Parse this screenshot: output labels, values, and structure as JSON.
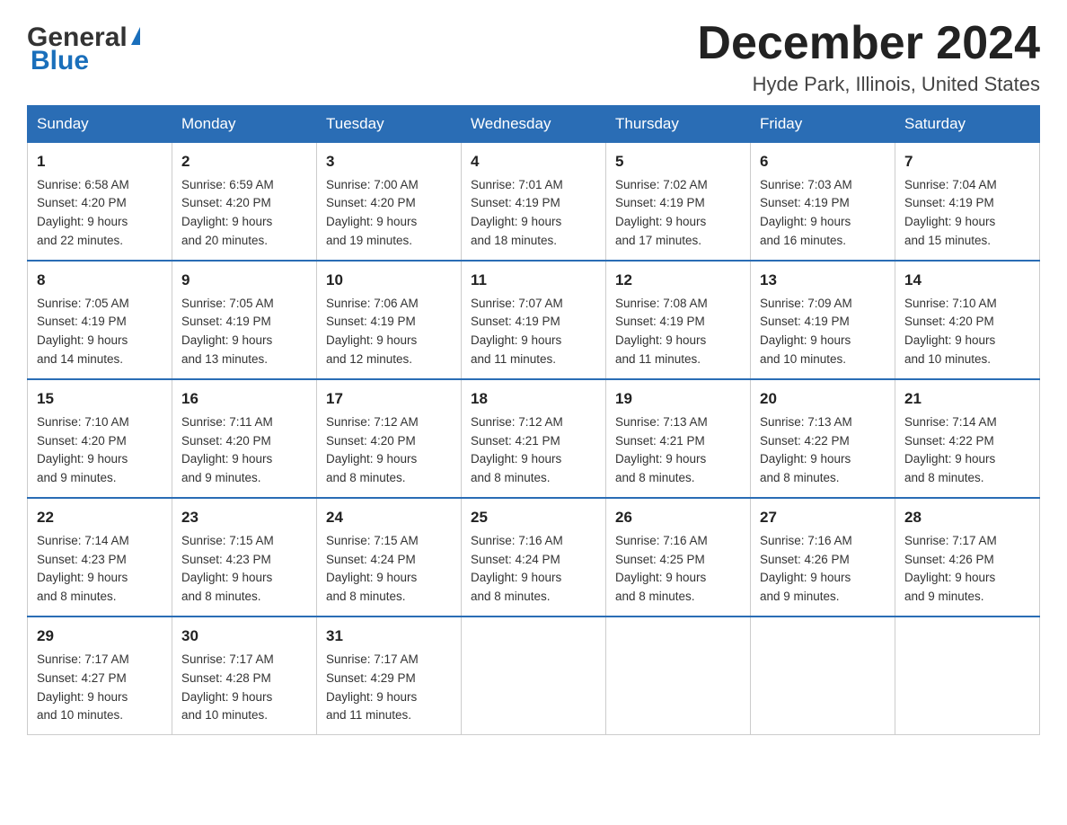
{
  "logo": {
    "general": "General",
    "blue": "Blue",
    "triangle": "▲"
  },
  "title": "December 2024",
  "location": "Hyde Park, Illinois, United States",
  "days_of_week": [
    "Sunday",
    "Monday",
    "Tuesday",
    "Wednesday",
    "Thursday",
    "Friday",
    "Saturday"
  ],
  "weeks": [
    [
      {
        "day": "1",
        "sunrise": "6:58 AM",
        "sunset": "4:20 PM",
        "daylight": "9 hours and 22 minutes."
      },
      {
        "day": "2",
        "sunrise": "6:59 AM",
        "sunset": "4:20 PM",
        "daylight": "9 hours and 20 minutes."
      },
      {
        "day": "3",
        "sunrise": "7:00 AM",
        "sunset": "4:20 PM",
        "daylight": "9 hours and 19 minutes."
      },
      {
        "day": "4",
        "sunrise": "7:01 AM",
        "sunset": "4:19 PM",
        "daylight": "9 hours and 18 minutes."
      },
      {
        "day": "5",
        "sunrise": "7:02 AM",
        "sunset": "4:19 PM",
        "daylight": "9 hours and 17 minutes."
      },
      {
        "day": "6",
        "sunrise": "7:03 AM",
        "sunset": "4:19 PM",
        "daylight": "9 hours and 16 minutes."
      },
      {
        "day": "7",
        "sunrise": "7:04 AM",
        "sunset": "4:19 PM",
        "daylight": "9 hours and 15 minutes."
      }
    ],
    [
      {
        "day": "8",
        "sunrise": "7:05 AM",
        "sunset": "4:19 PM",
        "daylight": "9 hours and 14 minutes."
      },
      {
        "day": "9",
        "sunrise": "7:05 AM",
        "sunset": "4:19 PM",
        "daylight": "9 hours and 13 minutes."
      },
      {
        "day": "10",
        "sunrise": "7:06 AM",
        "sunset": "4:19 PM",
        "daylight": "9 hours and 12 minutes."
      },
      {
        "day": "11",
        "sunrise": "7:07 AM",
        "sunset": "4:19 PM",
        "daylight": "9 hours and 11 minutes."
      },
      {
        "day": "12",
        "sunrise": "7:08 AM",
        "sunset": "4:19 PM",
        "daylight": "9 hours and 11 minutes."
      },
      {
        "day": "13",
        "sunrise": "7:09 AM",
        "sunset": "4:19 PM",
        "daylight": "9 hours and 10 minutes."
      },
      {
        "day": "14",
        "sunrise": "7:10 AM",
        "sunset": "4:20 PM",
        "daylight": "9 hours and 10 minutes."
      }
    ],
    [
      {
        "day": "15",
        "sunrise": "7:10 AM",
        "sunset": "4:20 PM",
        "daylight": "9 hours and 9 minutes."
      },
      {
        "day": "16",
        "sunrise": "7:11 AM",
        "sunset": "4:20 PM",
        "daylight": "9 hours and 9 minutes."
      },
      {
        "day": "17",
        "sunrise": "7:12 AM",
        "sunset": "4:20 PM",
        "daylight": "9 hours and 8 minutes."
      },
      {
        "day": "18",
        "sunrise": "7:12 AM",
        "sunset": "4:21 PM",
        "daylight": "9 hours and 8 minutes."
      },
      {
        "day": "19",
        "sunrise": "7:13 AM",
        "sunset": "4:21 PM",
        "daylight": "9 hours and 8 minutes."
      },
      {
        "day": "20",
        "sunrise": "7:13 AM",
        "sunset": "4:22 PM",
        "daylight": "9 hours and 8 minutes."
      },
      {
        "day": "21",
        "sunrise": "7:14 AM",
        "sunset": "4:22 PM",
        "daylight": "9 hours and 8 minutes."
      }
    ],
    [
      {
        "day": "22",
        "sunrise": "7:14 AM",
        "sunset": "4:23 PM",
        "daylight": "9 hours and 8 minutes."
      },
      {
        "day": "23",
        "sunrise": "7:15 AM",
        "sunset": "4:23 PM",
        "daylight": "9 hours and 8 minutes."
      },
      {
        "day": "24",
        "sunrise": "7:15 AM",
        "sunset": "4:24 PM",
        "daylight": "9 hours and 8 minutes."
      },
      {
        "day": "25",
        "sunrise": "7:16 AM",
        "sunset": "4:24 PM",
        "daylight": "9 hours and 8 minutes."
      },
      {
        "day": "26",
        "sunrise": "7:16 AM",
        "sunset": "4:25 PM",
        "daylight": "9 hours and 8 minutes."
      },
      {
        "day": "27",
        "sunrise": "7:16 AM",
        "sunset": "4:26 PM",
        "daylight": "9 hours and 9 minutes."
      },
      {
        "day": "28",
        "sunrise": "7:17 AM",
        "sunset": "4:26 PM",
        "daylight": "9 hours and 9 minutes."
      }
    ],
    [
      {
        "day": "29",
        "sunrise": "7:17 AM",
        "sunset": "4:27 PM",
        "daylight": "9 hours and 10 minutes."
      },
      {
        "day": "30",
        "sunrise": "7:17 AM",
        "sunset": "4:28 PM",
        "daylight": "9 hours and 10 minutes."
      },
      {
        "day": "31",
        "sunrise": "7:17 AM",
        "sunset": "4:29 PM",
        "daylight": "9 hours and 11 minutes."
      },
      null,
      null,
      null,
      null
    ]
  ],
  "labels": {
    "sunrise": "Sunrise:",
    "sunset": "Sunset:",
    "daylight": "Daylight:"
  }
}
